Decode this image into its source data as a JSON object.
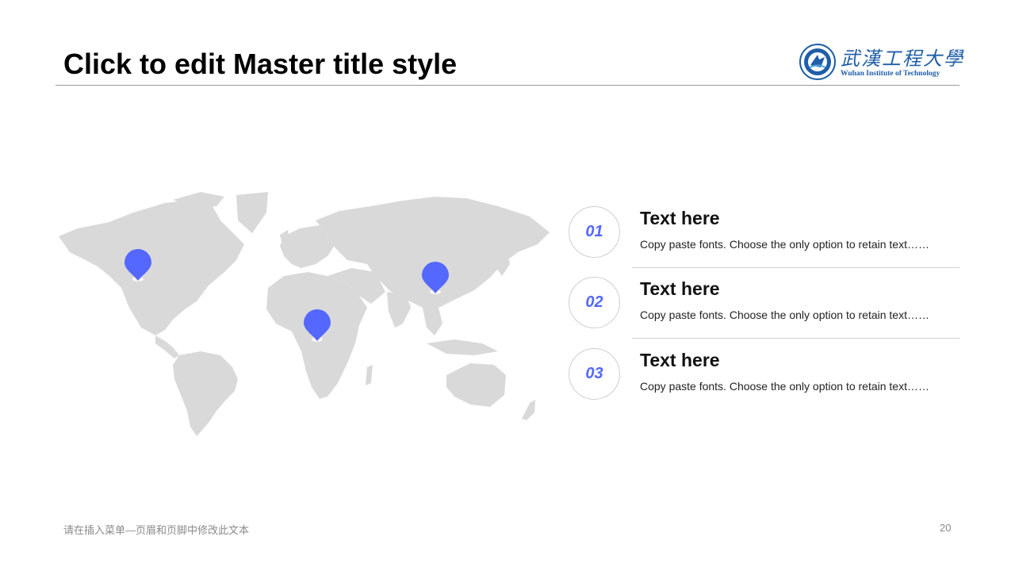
{
  "slide": {
    "title": "Click to edit Master title style",
    "footer_text": "请在插入菜单—页眉和页脚中修改此文本",
    "page_number": "20"
  },
  "logo": {
    "chinese_name": "武漢工程大學",
    "english_name": "Wuhan Institute of Technology",
    "seal_year": "1972",
    "color": "#1f5ea8"
  },
  "map": {
    "land_color": "#d9d9d9",
    "pin_color": "#5468ff",
    "pin_icon": "map-pin-icon",
    "pins": [
      {
        "name": "North America"
      },
      {
        "name": "Africa"
      },
      {
        "name": "East Asia"
      }
    ]
  },
  "items": [
    {
      "number": "01",
      "heading": "Text here",
      "description": "Copy paste fonts. Choose the only option to retain text……"
    },
    {
      "number": "02",
      "heading": "Text here",
      "description": "Copy paste fonts. Choose the only option to retain text……"
    },
    {
      "number": "03",
      "heading": "Text here",
      "description": "Copy paste fonts. Choose the only option to retain text……"
    }
  ],
  "colors": {
    "accent": "#5468ff",
    "circle_border": "#cfcfcf",
    "divider": "#d0d0d0"
  }
}
